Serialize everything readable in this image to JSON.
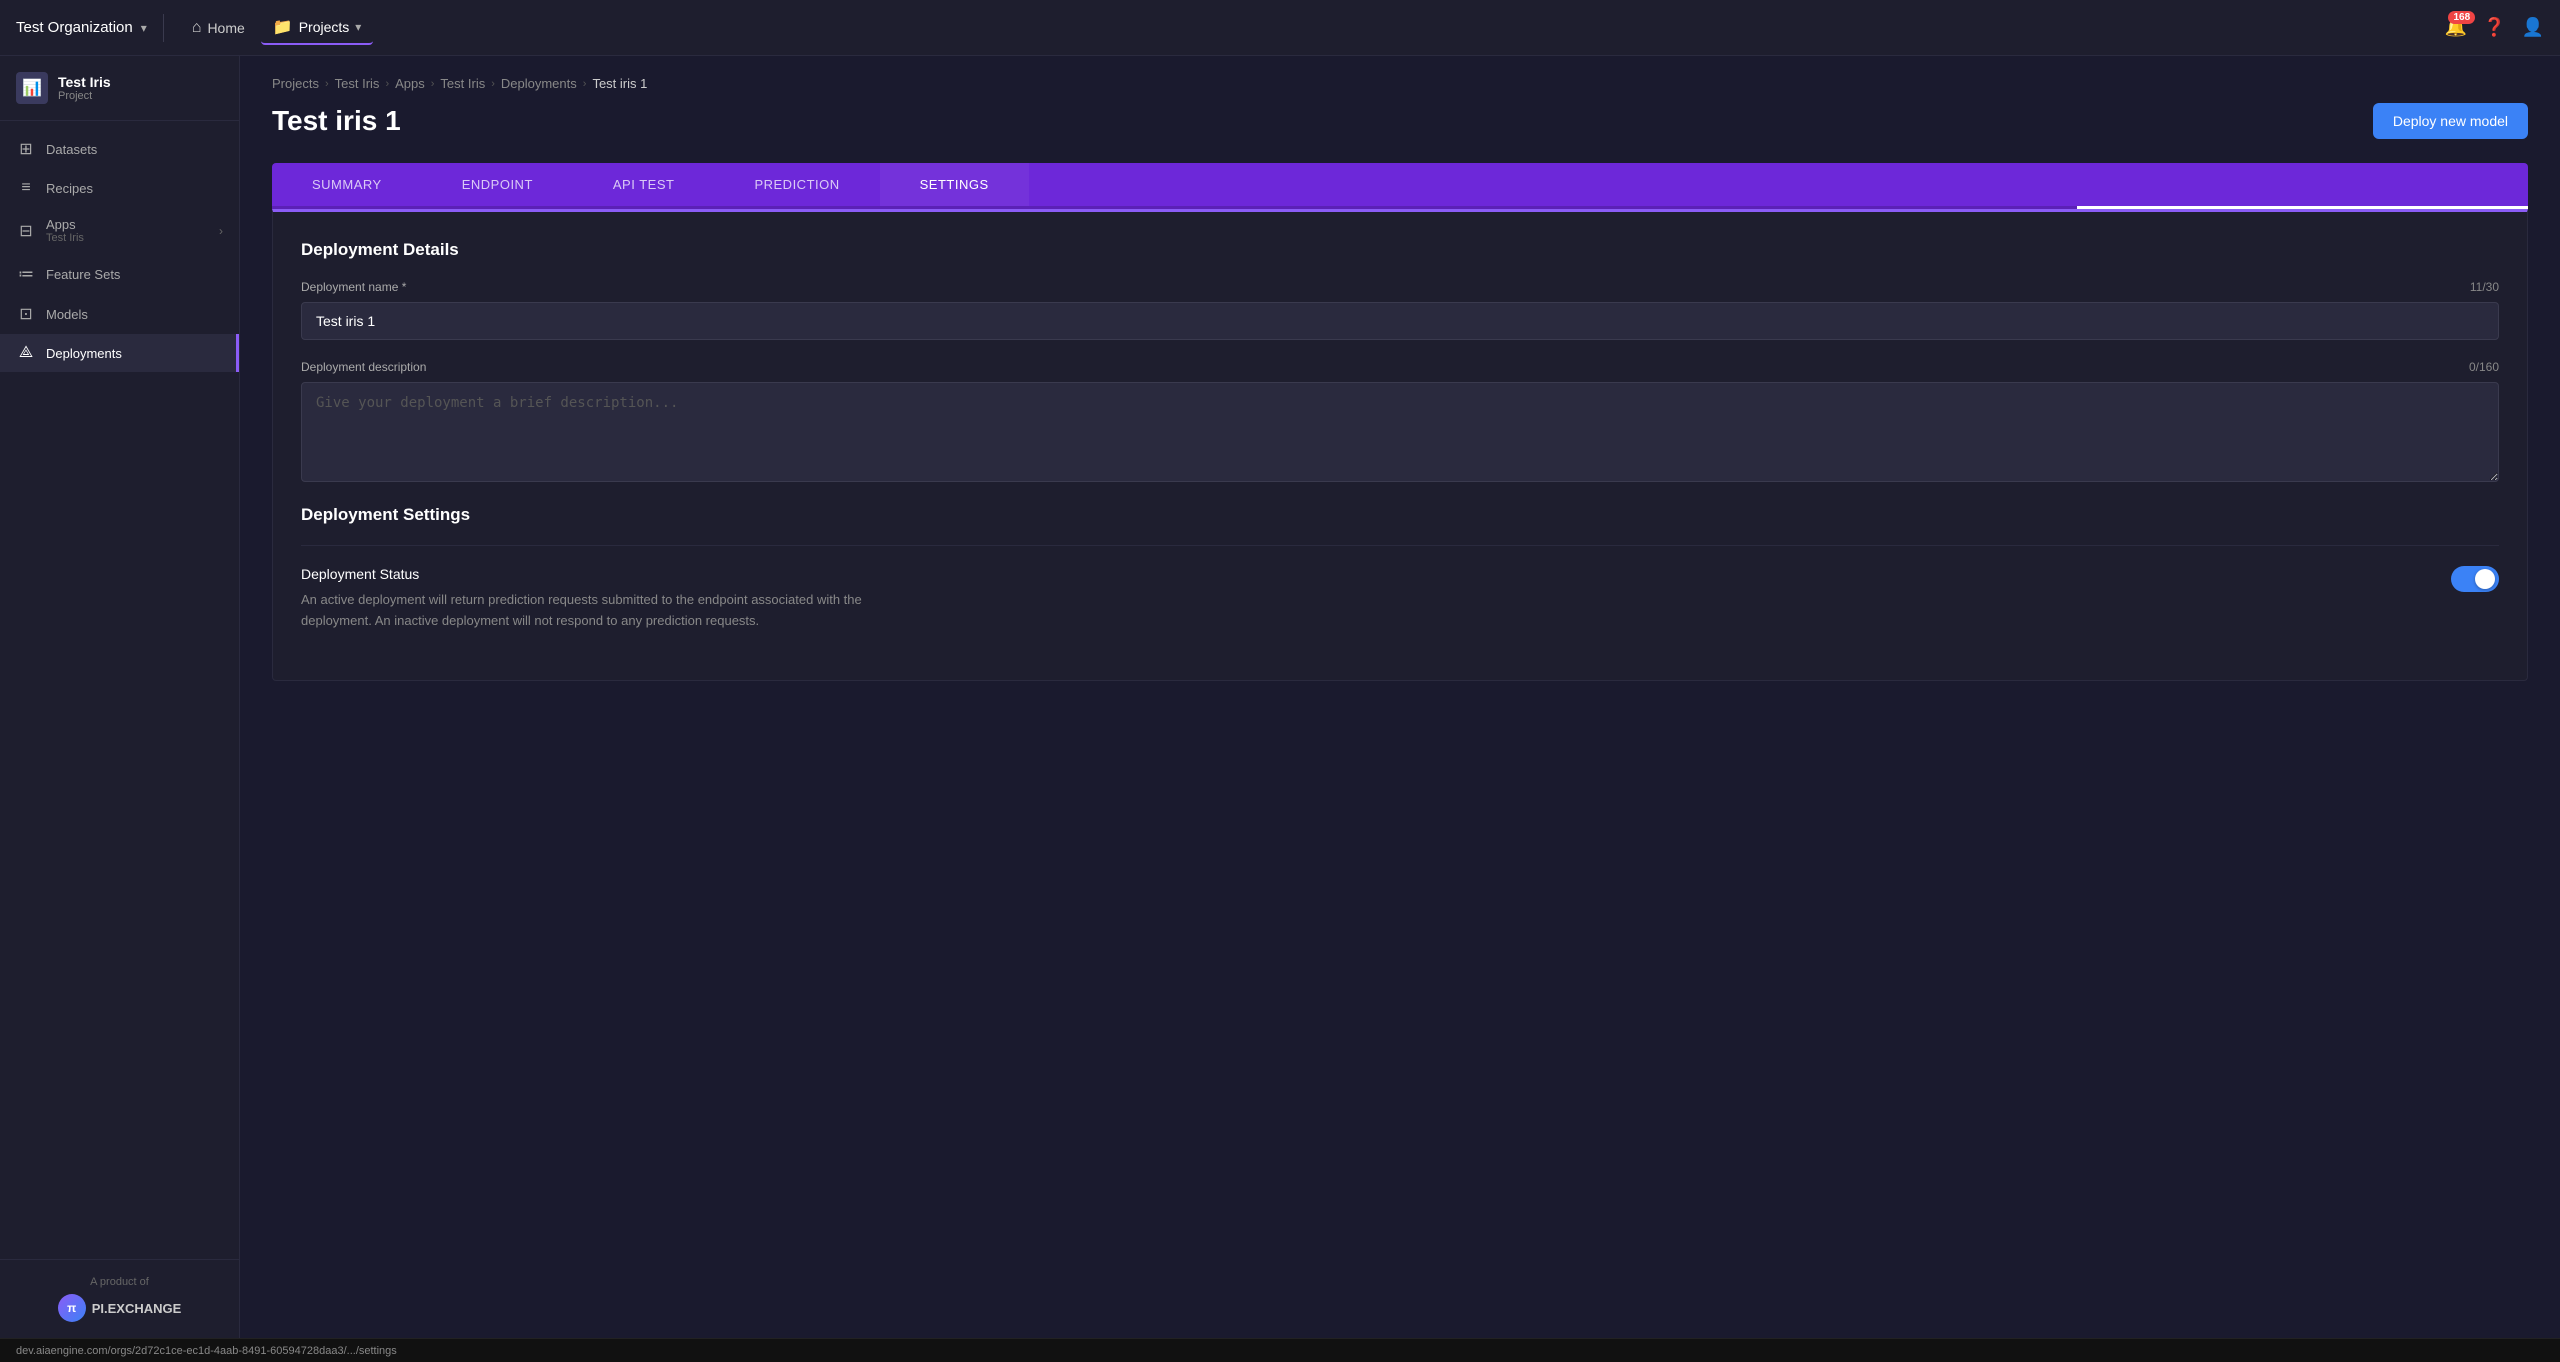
{
  "topnav": {
    "org_name": "Test Organization",
    "chevron": "▾",
    "home_label": "Home",
    "projects_label": "Projects",
    "notification_count": "168",
    "help_icon": "?",
    "user_icon": "👤"
  },
  "sidebar": {
    "project_name": "Test Iris",
    "project_type": "Project",
    "items": [
      {
        "id": "datasets",
        "icon": "⊞",
        "label": "Datasets"
      },
      {
        "id": "recipes",
        "icon": "≡",
        "label": "Recipes"
      },
      {
        "id": "apps",
        "icon": "⊟",
        "label": "Apps",
        "sub": "Test Iris",
        "has_chevron": true
      },
      {
        "id": "feature-sets",
        "icon": "≔",
        "label": "Feature Sets"
      },
      {
        "id": "models",
        "icon": "⊡",
        "label": "Models"
      },
      {
        "id": "deployments",
        "icon": "⟁",
        "label": "Deployments",
        "active": true
      }
    ],
    "footer_text": "A product of",
    "logo_text": "PI.EXCHANGE"
  },
  "breadcrumb": {
    "items": [
      {
        "label": "Projects",
        "active": false
      },
      {
        "label": "Test Iris",
        "active": false
      },
      {
        "label": "Apps",
        "active": false
      },
      {
        "label": "Test Iris",
        "active": false
      },
      {
        "label": "Deployments",
        "active": false
      },
      {
        "label": "Test iris 1",
        "active": true
      }
    ]
  },
  "page": {
    "title": "Test iris 1",
    "deploy_btn": "Deploy new model"
  },
  "tabs": {
    "items": [
      {
        "id": "summary",
        "label": "SUMMARY",
        "active": false
      },
      {
        "id": "endpoint",
        "label": "ENDPOINT",
        "active": false
      },
      {
        "id": "api-test",
        "label": "API TEST",
        "active": false
      },
      {
        "id": "prediction",
        "label": "PREDICTION",
        "active": false
      },
      {
        "id": "settings",
        "label": "SETTINGS",
        "active": true
      }
    ]
  },
  "settings": {
    "section_title": "Deployment Details",
    "deployment_name_label": "Deployment name *",
    "deployment_name_counter": "11/30",
    "deployment_name_value": "Test iris 1",
    "deployment_desc_label": "Deployment description",
    "deployment_desc_counter": "0/160",
    "deployment_desc_placeholder": "Give your deployment a brief description...",
    "settings_section_title": "Deployment Settings",
    "status_label": "Deployment Status",
    "status_desc": "An active deployment will return prediction requests submitted to the endpoint associated with the deployment. An inactive deployment will not respond to any prediction requests.",
    "status_enabled": true
  },
  "statusbar": {
    "url": "dev.aiaengine.com/orgs/2d72c1ce-ec1d-4aab-8491-60594728daa3/.../settings"
  }
}
